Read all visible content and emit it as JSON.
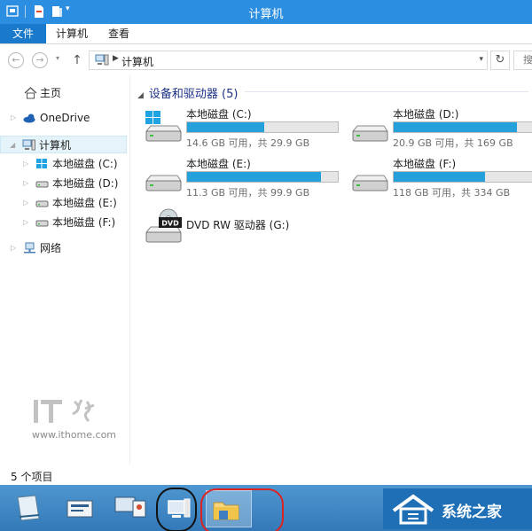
{
  "window": {
    "title": "计算机"
  },
  "ribbon": {
    "tabs": [
      "文件",
      "计算机",
      "查看"
    ]
  },
  "address": {
    "location": "计算机"
  },
  "nav": {
    "items": [
      {
        "label": "主页"
      },
      {
        "label": "OneDrive"
      },
      {
        "label": "计算机"
      },
      {
        "label": "本地磁盘 (C:)"
      },
      {
        "label": "本地磁盘 (D:)"
      },
      {
        "label": "本地磁盘 (E:)"
      },
      {
        "label": "本地磁盘 (F:)"
      },
      {
        "label": "网络"
      }
    ]
  },
  "content": {
    "group_title": "设备和驱动器 (5)",
    "drives": [
      {
        "name": "本地磁盘 (C:)",
        "info": "14.6 GB 可用，共 29.9 GB",
        "used_fraction": 0.51
      },
      {
        "name": "本地磁盘 (D:)",
        "info": "20.9 GB 可用，共 169 GB",
        "used_fraction": 0.88
      },
      {
        "name": "本地磁盘 (E:)",
        "info": "11.3 GB 可用，共 99.9 GB",
        "used_fraction": 0.89
      },
      {
        "name": "本地磁盘 (F:)",
        "info": "118 GB 可用，共 334 GB",
        "used_fraction": 0.65
      },
      {
        "name": "DVD RW 驱动器 (G:)"
      }
    ]
  },
  "status": {
    "count": "5 个项目"
  },
  "watermark": {
    "url": "www.ithome.com"
  },
  "logo": {
    "text": "系统之家"
  },
  "colors": {
    "accent": "#2b8ee0",
    "file_tab": "#1979ca",
    "bar_fill": "#26a0da",
    "taskbar": "#3a82c2"
  }
}
